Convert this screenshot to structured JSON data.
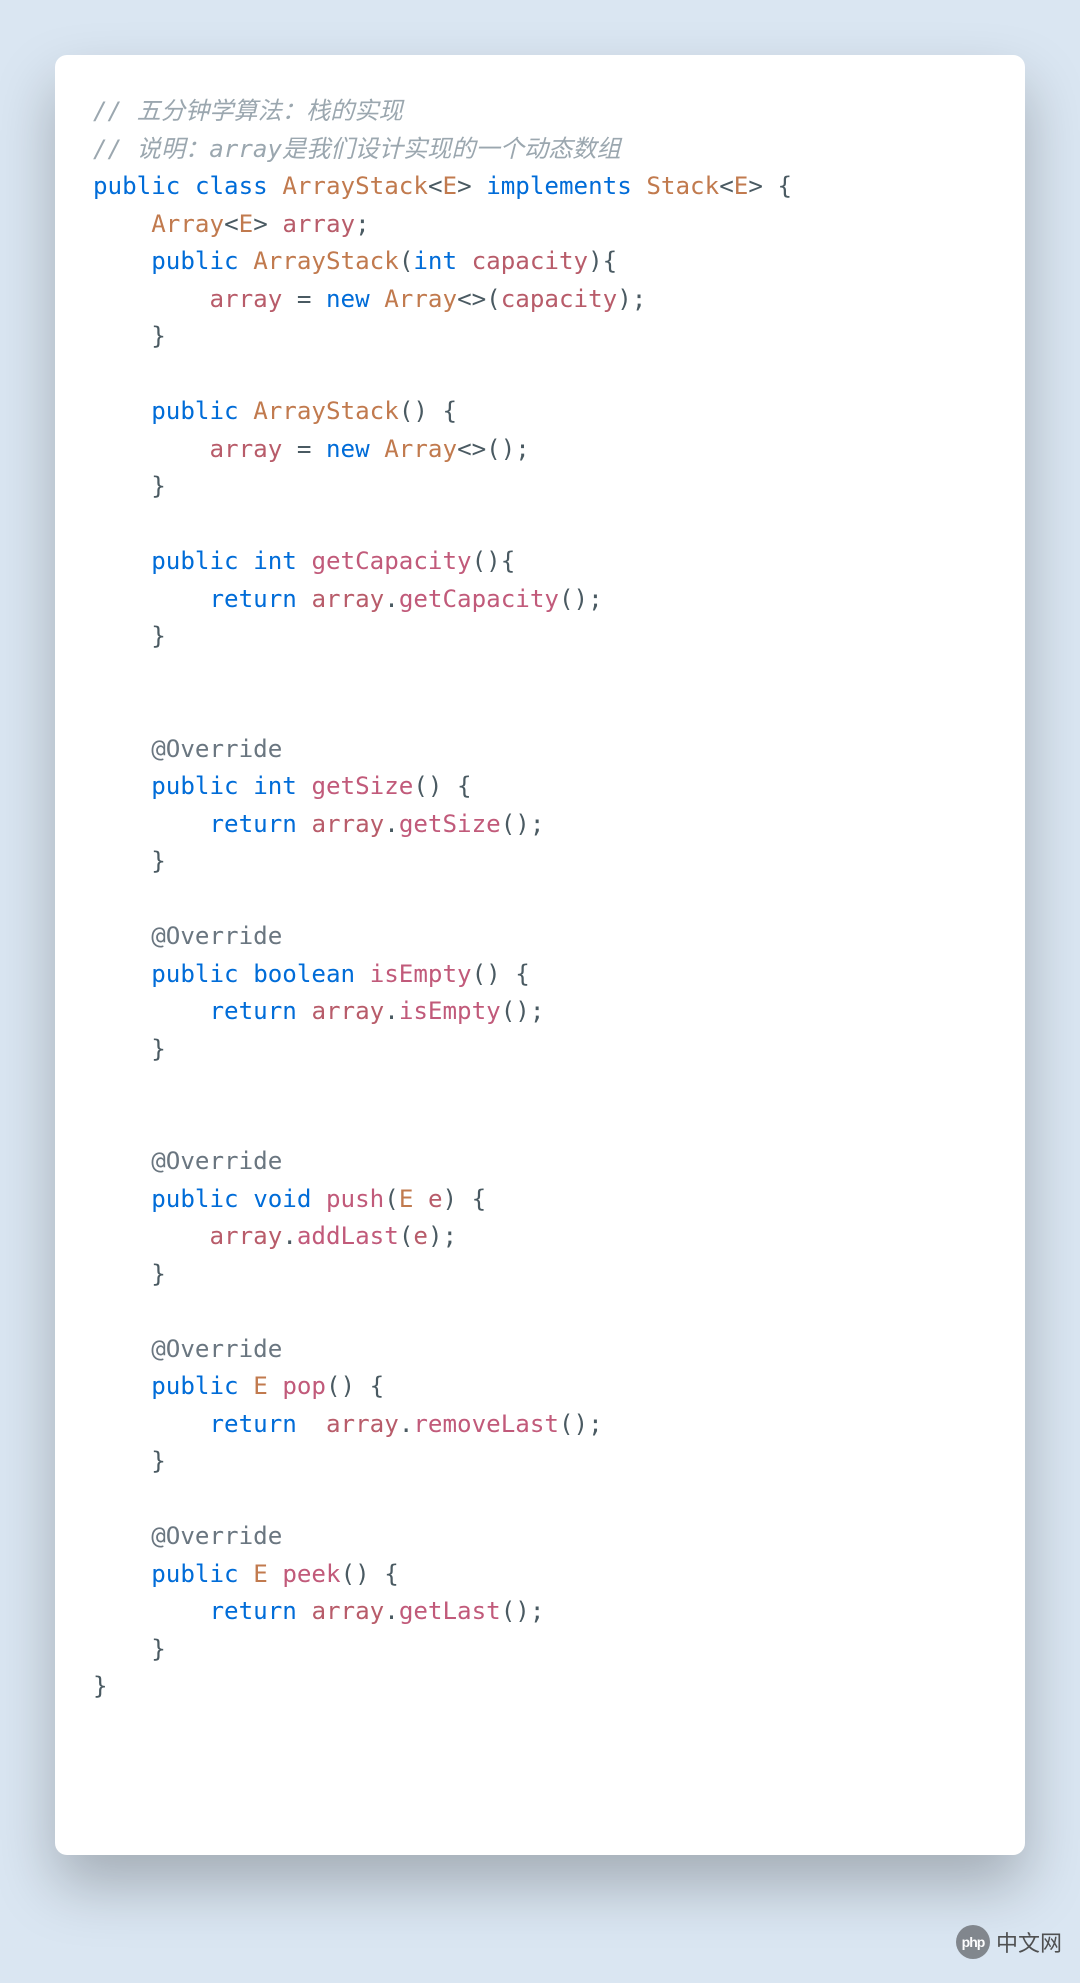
{
  "code": {
    "comment1": "// 五分钟学算法：栈的实现",
    "comment2": "// 说明：array是我们设计实现的一个动态数组",
    "kw_public": "public",
    "kw_class": "class",
    "kw_implements": "implements",
    "kw_int": "int",
    "kw_void": "void",
    "kw_boolean": "boolean",
    "kw_new": "new",
    "kw_return": "return",
    "ty_ArrayStack": "ArrayStack",
    "ty_Stack": "Stack",
    "ty_Array": "Array",
    "ty_E": "E",
    "id_array": "array",
    "id_capacity": "capacity",
    "id_e": "e",
    "mt_getCapacity": "getCapacity",
    "mt_getSize": "getSize",
    "mt_isEmpty": "isEmpty",
    "mt_push": "push",
    "mt_pop": "pop",
    "mt_peek": "peek",
    "mt_addLast": "addLast",
    "mt_removeLast": "removeLast",
    "mt_getLast": "getLast",
    "an_Override": "@Override"
  },
  "watermark": {
    "logo_text": "php",
    "label": "中文网"
  }
}
